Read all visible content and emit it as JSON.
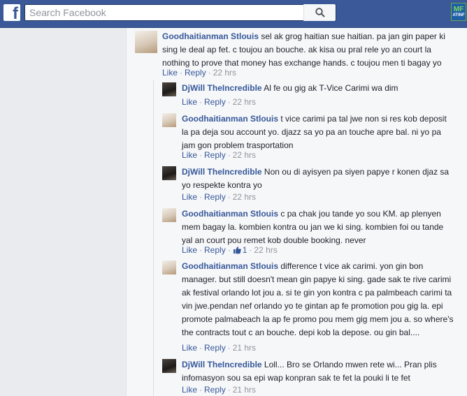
{
  "search": {
    "placeholder": "Search Facebook"
  },
  "logo": {
    "letter": "f"
  },
  "badge": {
    "line1": "MF",
    "line2": "ATINF"
  },
  "colors": {
    "brand": "#3b5998",
    "link": "#365899",
    "meta": "#90949c"
  },
  "icons": {
    "search": "search-icon",
    "like": "thumbs-up-icon"
  },
  "comments": [
    {
      "author": "Goodhaitianman Stlouis",
      "text": "sel ak grog haitian sue haitian. pa jan gin paper ki sing le deal ap fet. c toujou an bouche. ak kisa ou pral rele yo an court la nothing to prove that money has exchange hands. c toujou men ti bagay yo",
      "like": "Like",
      "reply": "Reply",
      "time": "22 hrs"
    },
    {
      "author": "DjWill TheIncredible",
      "text": "Al fe ou gig ak T-Vice Carimi wa dim",
      "like": "Like",
      "reply": "Reply",
      "time": "22 hrs"
    },
    {
      "author": "Goodhaitianman Stlouis",
      "text": "t vice carimi pa tal jwe non si res kob deposit la pa deja sou account yo. djazz sa yo pa an touche apre bal. ni yo pa jam gon problem trasportation",
      "like": "Like",
      "reply": "Reply",
      "time": "22 hrs"
    },
    {
      "author": "DjWill TheIncredible",
      "text": "Non ou di ayisyen pa siyen papye r konen djaz sa yo respekte kontra yo",
      "like": "Like",
      "reply": "Reply",
      "time": "22 hrs"
    },
    {
      "author": "Goodhaitianman Stlouis",
      "text": "c pa chak jou tande yo sou KM. ap plenyen mem bagay la. kombien kontra ou jan we ki sing. kombien foi ou tande yal an court pou remet kob double booking. never",
      "like": "Like",
      "reply": "Reply",
      "likes_count": "1",
      "time": "22 hrs"
    },
    {
      "author": "Goodhaitianman Stlouis",
      "text": "difference t vice ak carimi. yon gin bon manager. but still doesn't mean gin papye ki sing. gade sak te rive carimi ak festival orlando lot jou a. si te gin yon kontra c pa palmbeach carimi ta vin jwe.pendan nef orlando yo te gintan ap fe promotion pou gig la. epi promote palmabeach la ap fe promo pou mem gig mem jou a. so where's the contracts tout c an bouche. depi kob la depose. ou gin bal....",
      "like": "Like",
      "reply": "Reply",
      "time": "21 hrs"
    },
    {
      "author": "DjWill TheIncredible",
      "text": "Loll... Bro se Orlando mwen rete wi... Pran plis infomasyon sou sa epi wap konpran sak te fet la pouki li te fet",
      "like": "Like",
      "reply": "Reply",
      "time": "21 hrs"
    }
  ]
}
